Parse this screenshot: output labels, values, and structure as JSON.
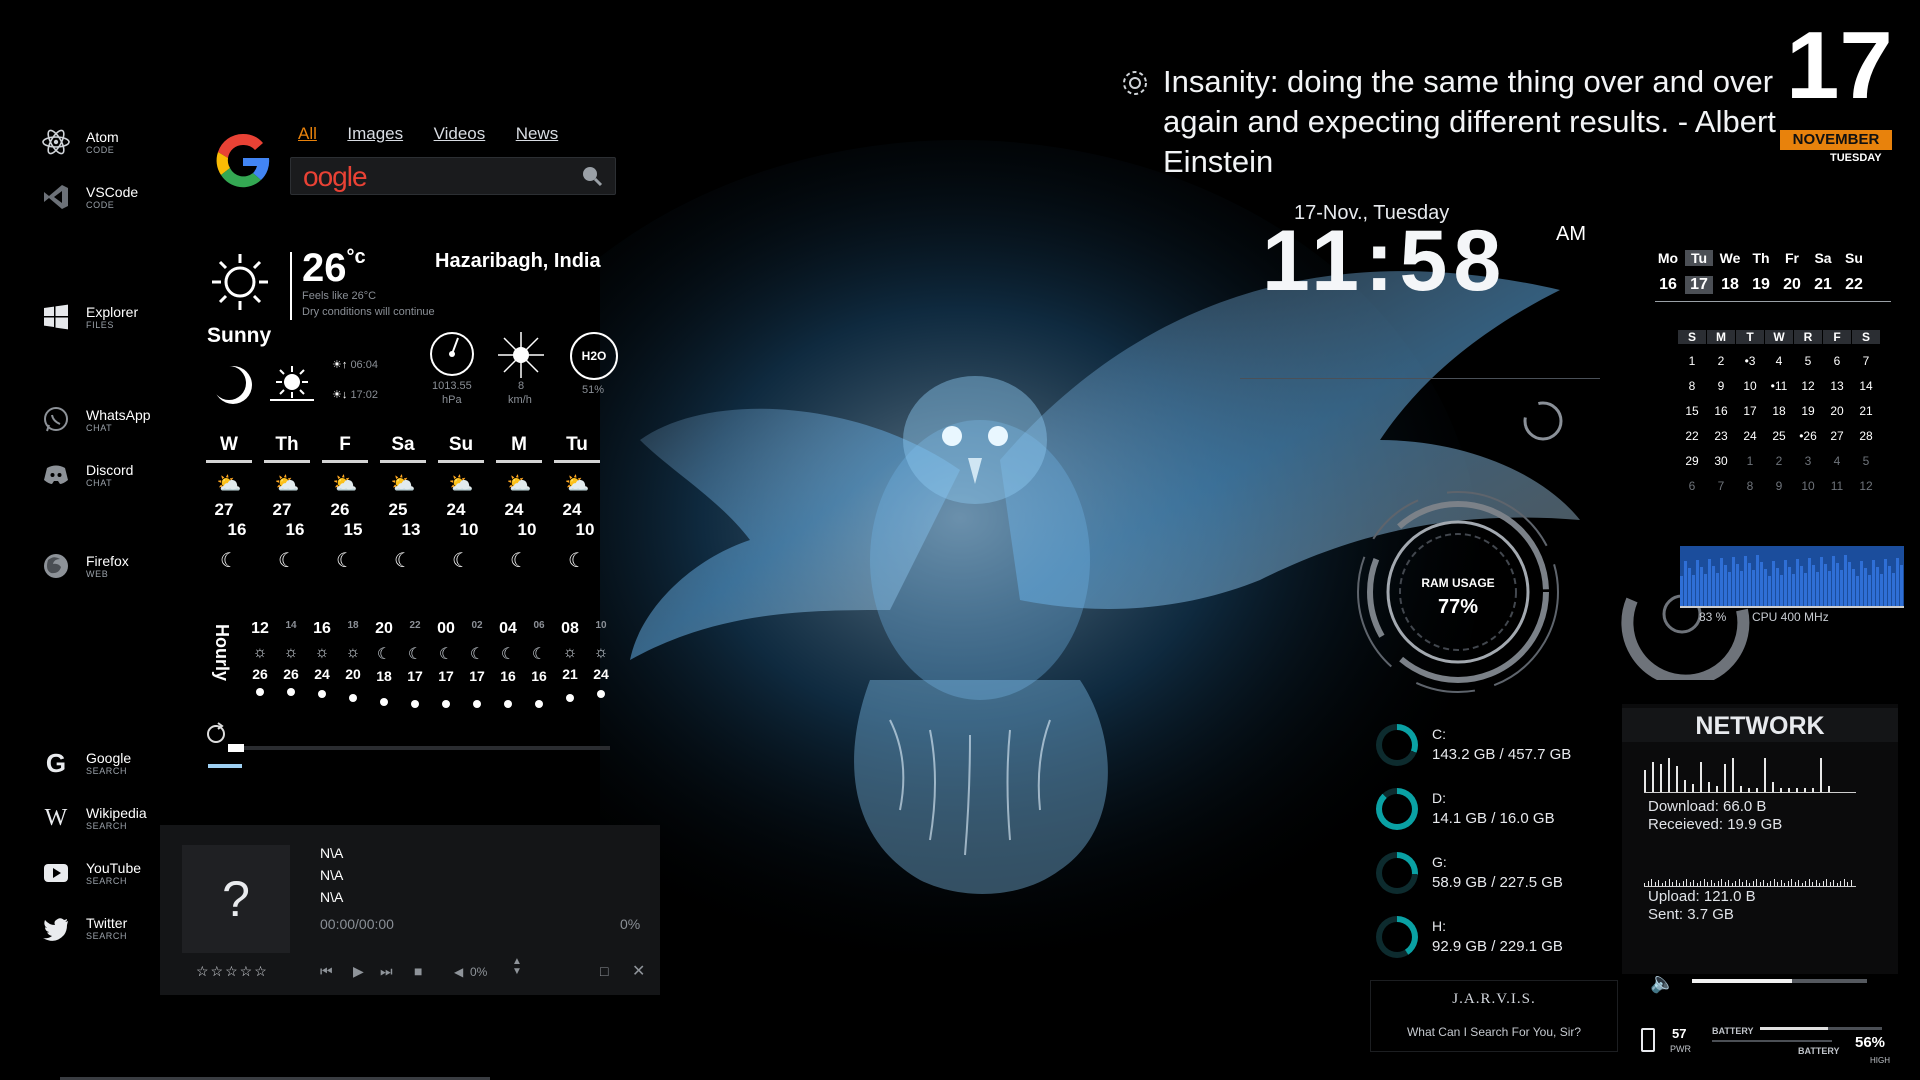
{
  "launcher": [
    {
      "name": "Atom",
      "sub": "CODE",
      "icon": "atom-icon"
    },
    {
      "name": "VSCode",
      "sub": "CODE",
      "icon": "vscode-icon"
    },
    {
      "name": "Explorer",
      "sub": "FILES",
      "icon": "windows-icon"
    },
    {
      "name": "WhatsApp",
      "sub": "CHAT",
      "icon": "whatsapp-icon"
    },
    {
      "name": "Discord",
      "sub": "CHAT",
      "icon": "discord-icon"
    },
    {
      "name": "Firefox",
      "sub": "WEB",
      "icon": "firefox-icon"
    },
    {
      "name": "Google",
      "sub": "SEARCH",
      "icon": "google-icon"
    },
    {
      "name": "Wikipedia",
      "sub": "SEARCH",
      "icon": "wikipedia-icon"
    },
    {
      "name": "YouTube",
      "sub": "SEARCH",
      "icon": "youtube-icon"
    },
    {
      "name": "Twitter",
      "sub": "SEARCH",
      "icon": "twitter-icon"
    }
  ],
  "google": {
    "tabs": [
      "All",
      "Images",
      "Videos",
      "News"
    ],
    "search_value": "oogle"
  },
  "weather": {
    "temp": "26",
    "unit": "°c",
    "feels": "Feels like 26°C",
    "desc": "Dry conditions will continue",
    "condition": "Sunny",
    "location": "Hazaribagh, India",
    "sunrise": "06:04",
    "sunset": "17:02",
    "pressure": "1013.55",
    "pressure_unit": "hPa",
    "wind": "8",
    "wind_unit": "km/h",
    "humidity_label": "H2O",
    "humidity": "51%",
    "days": [
      {
        "d": "W",
        "hi": "27",
        "lo": "16"
      },
      {
        "d": "Th",
        "hi": "27",
        "lo": "16"
      },
      {
        "d": "F",
        "hi": "26",
        "lo": "15"
      },
      {
        "d": "Sa",
        "hi": "25",
        "lo": "13"
      },
      {
        "d": "Su",
        "hi": "24",
        "lo": "10"
      },
      {
        "d": "M",
        "hi": "24",
        "lo": "10"
      },
      {
        "d": "Tu",
        "hi": "24",
        "lo": "10"
      }
    ],
    "hourly_label": "Hourly",
    "hours": [
      "12",
      "14",
      "16",
      "18",
      "20",
      "22",
      "00",
      "02",
      "04",
      "06",
      "08",
      "10"
    ],
    "hour_temps": [
      "26",
      "26",
      "24",
      "20",
      "18",
      "17",
      "17",
      "17",
      "16",
      "16",
      "21",
      "24"
    ]
  },
  "player": {
    "art": "?",
    "title": "N\\A",
    "artist": "N\\A",
    "album": "N\\A",
    "time": "00:00/00:00",
    "progress": "0%",
    "volume": "0%",
    "rating": "☆☆☆☆☆"
  },
  "quote": "Insanity: doing the same thing over and over again and expecting different results. - Albert Einstein",
  "date": {
    "day": "17",
    "month": "NOVEMBER",
    "weekday": "TUESDAY"
  },
  "clock": {
    "subtitle": "17-Nov., Tuesday",
    "time": "11:58",
    "ampm": "AM"
  },
  "week_strip": {
    "days": [
      "Mo",
      "Tu",
      "We",
      "Th",
      "Fr",
      "Sa",
      "Su"
    ],
    "dates": [
      "16",
      "17",
      "18",
      "19",
      "20",
      "21",
      "22"
    ]
  },
  "month_cal": {
    "headers": [
      "S",
      "M",
      "T",
      "W",
      "R",
      "F",
      "S"
    ],
    "rows": [
      [
        "1",
        "2",
        "•3",
        "4",
        "5",
        "6",
        "7"
      ],
      [
        "8",
        "9",
        "10",
        "•11",
        "12",
        "13",
        "14"
      ],
      [
        "15",
        "16",
        "17",
        "18",
        "19",
        "20",
        "21"
      ],
      [
        "22",
        "23",
        "24",
        "25",
        "•26",
        "27",
        "28"
      ],
      [
        "29",
        "30",
        "1",
        "2",
        "3",
        "4",
        "5"
      ],
      [
        "6",
        "7",
        "8",
        "9",
        "10",
        "11",
        "12"
      ]
    ]
  },
  "ram": {
    "label": "RAM USAGE",
    "value": "77%"
  },
  "cpu": {
    "usage": "83 %",
    "freq": "CPU 400 MHz"
  },
  "disks": [
    {
      "label": "C:",
      "value": "143.2 GB / 457.7 GB",
      "pct": 31
    },
    {
      "label": "D:",
      "value": "14.1 GB / 16.0 GB",
      "pct": 88
    },
    {
      "label": "G:",
      "value": "58.9 GB / 227.5 GB",
      "pct": 26
    },
    {
      "label": "H:",
      "value": "92.9 GB / 229.1 GB",
      "pct": 41
    }
  ],
  "network": {
    "title": "NETWORK",
    "download": "Download: 66.0 B",
    "received": "Receieved: 19.9 GB",
    "upload": "Upload: 121.0 B",
    "sent": "Sent: 3.7 GB"
  },
  "jarvis": {
    "title": "J.A.R.V.I.S.",
    "prompt": "What Can I Search For You, Sir?"
  },
  "power": {
    "value": "57",
    "label": "PWR",
    "battery_label": "BATTERY",
    "battery_label2": "BATTERY",
    "battery_pct": "56%",
    "high": "HIGH"
  },
  "colors": {
    "accent_orange": "#e8820c",
    "cyan": "#0aa1a4",
    "cpu_blue": "#2f6fd6"
  }
}
